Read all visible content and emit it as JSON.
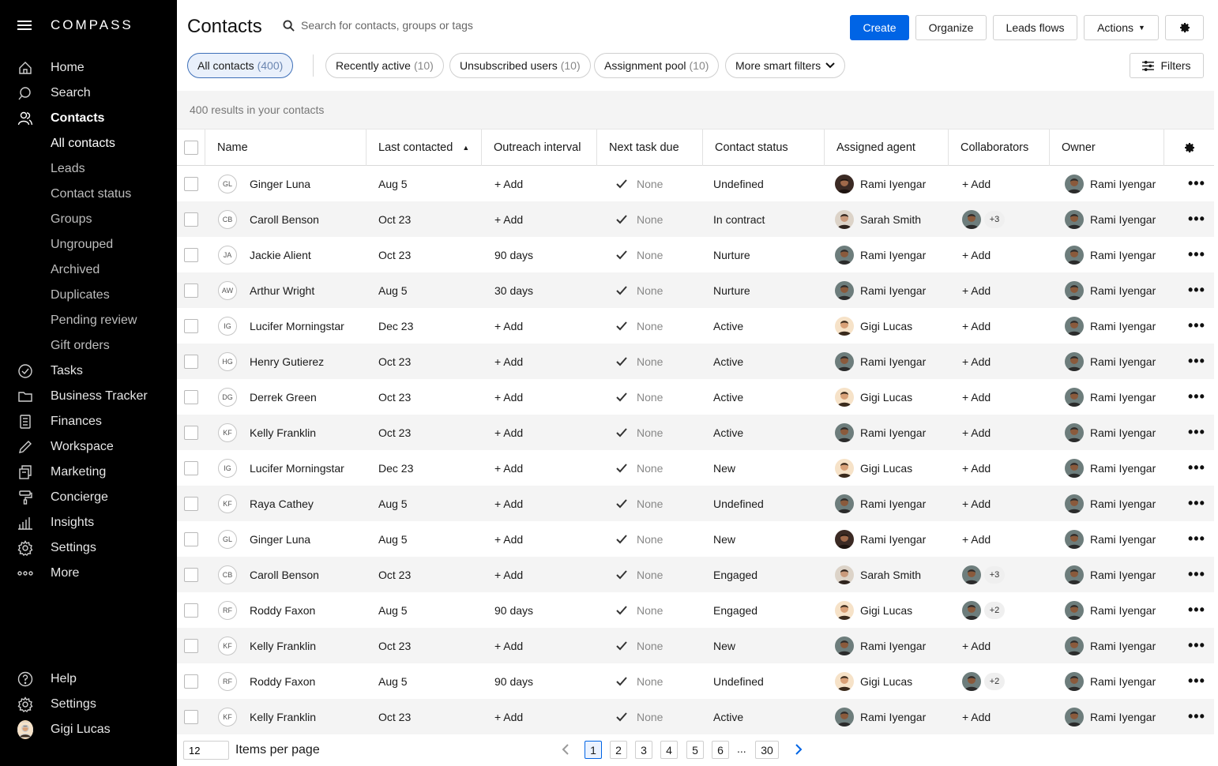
{
  "brand": "COMPASS",
  "nav": [
    {
      "label": "Home",
      "icon": "home-icon"
    },
    {
      "label": "Search",
      "icon": "search-icon"
    },
    {
      "label": "Contacts",
      "icon": "contacts-icon",
      "active": true
    }
  ],
  "subnav": [
    "All contacts",
    "Leads",
    "Contact status",
    "Groups",
    "Ungrouped",
    "Archived",
    "Duplicates",
    "Pending review",
    "Gift orders"
  ],
  "nav2": [
    {
      "label": "Tasks",
      "icon": "tasks-icon"
    },
    {
      "label": "Business Tracker",
      "icon": "folder-icon"
    },
    {
      "label": "Finances",
      "icon": "calculator-icon"
    },
    {
      "label": "Workspace",
      "icon": "pencil-icon"
    },
    {
      "label": "Marketing",
      "icon": "marketing-icon"
    },
    {
      "label": "Concierge",
      "icon": "paint-roller-icon"
    },
    {
      "label": "Insights",
      "icon": "bar-chart-icon"
    },
    {
      "label": "Settings",
      "icon": "gear-icon"
    },
    {
      "label": "More",
      "icon": "more-icon"
    }
  ],
  "bottom_nav": [
    {
      "label": "Help",
      "icon": "help-icon"
    },
    {
      "label": "Settings",
      "icon": "gear-icon"
    }
  ],
  "user": {
    "name": "Gigi Lucas"
  },
  "header": {
    "title": "Contacts",
    "search_placeholder": "Search for contacts, groups or tags",
    "create": "Create",
    "organize": "Organize",
    "leads_flows": "Leads flows",
    "actions": "Actions"
  },
  "filters": {
    "chips": [
      {
        "label": "All contacts",
        "count": "(400)"
      },
      {
        "label": "Recently active",
        "count": "(10)"
      },
      {
        "label": "Unsubscribed users",
        "count": "(10)"
      },
      {
        "label": "Assignment pool",
        "count": "(10)"
      }
    ],
    "more_smart": "More smart filters",
    "filters_btn": "Filters"
  },
  "results_text": "400 results in your contacts",
  "columns": [
    "Name",
    "Last contacted",
    "Outreach interval",
    "Next task due",
    "Contact status",
    "Assigned agent",
    "Collaborators",
    "Owner"
  ],
  "rows": [
    {
      "initials": "GL",
      "name": "Ginger Luna",
      "last": "Aug 5",
      "interval": "+ Add",
      "task": "None",
      "status": "Undefined",
      "agent": "Rami Iyengar",
      "agent_av": "woman-dark",
      "collab": "+ Add",
      "owner": "Rami Iyengar"
    },
    {
      "initials": "CB",
      "name": "Caroll Benson",
      "last": "Oct 23",
      "interval": "+ Add",
      "task": "None",
      "status": "In contract",
      "agent": "Sarah Smith",
      "agent_av": "woman-light",
      "collab": "+3",
      "owner": "Rami Iyengar"
    },
    {
      "initials": "JA",
      "name": "Jackie Alient",
      "last": "Oct 23",
      "interval": "90 days",
      "task": "None",
      "status": "Nurture",
      "agent": "Rami Iyengar",
      "agent_av": "man",
      "collab": "+ Add",
      "owner": "Rami Iyengar"
    },
    {
      "initials": "AW",
      "name": "Arthur Wright",
      "last": "Aug 5",
      "interval": "30 days",
      "task": "None",
      "status": "Nurture",
      "agent": "Rami Iyengar",
      "agent_av": "man",
      "collab": "+ Add",
      "owner": "Rami Iyengar"
    },
    {
      "initials": "IG",
      "name": "Lucifer Morningstar",
      "last": "Dec 23",
      "interval": "+ Add",
      "task": "None",
      "status": "Active",
      "agent": "Gigi Lucas",
      "agent_av": "gigi",
      "collab": "+ Add",
      "owner": "Rami Iyengar"
    },
    {
      "initials": "HG",
      "name": "Henry Gutierez",
      "last": "Oct 23",
      "interval": "+ Add",
      "task": "None",
      "status": "Active",
      "agent": "Rami Iyengar",
      "agent_av": "man",
      "collab": "+ Add",
      "owner": "Rami Iyengar"
    },
    {
      "initials": "DG",
      "name": "Derrek Green",
      "last": "Oct 23",
      "interval": "+ Add",
      "task": "None",
      "status": "Active",
      "agent": "Gigi Lucas",
      "agent_av": "gigi",
      "collab": "+ Add",
      "owner": "Rami Iyengar"
    },
    {
      "initials": "KF",
      "name": "Kelly Franklin",
      "last": "Oct 23",
      "interval": "+ Add",
      "task": "None",
      "status": "Active",
      "agent": "Rami Iyengar",
      "agent_av": "man",
      "collab": "+ Add",
      "owner": "Rami Iyengar"
    },
    {
      "initials": "IG",
      "name": "Lucifer Morningstar",
      "last": "Dec 23",
      "interval": "+ Add",
      "task": "None",
      "status": "New",
      "agent": "Gigi Lucas",
      "agent_av": "gigi",
      "collab": "+ Add",
      "owner": "Rami Iyengar"
    },
    {
      "initials": "KF",
      "name": "Raya Cathey",
      "last": "Aug 5",
      "interval": "+ Add",
      "task": "None",
      "status": "Undefined",
      "agent": "Rami Iyengar",
      "agent_av": "man",
      "collab": "+ Add",
      "owner": "Rami Iyengar"
    },
    {
      "initials": "GL",
      "name": "Ginger Luna",
      "last": "Aug 5",
      "interval": "+ Add",
      "task": "None",
      "status": "New",
      "agent": "Rami Iyengar",
      "agent_av": "woman-dark",
      "collab": "+ Add",
      "owner": "Rami Iyengar"
    },
    {
      "initials": "CB",
      "name": "Caroll Benson",
      "last": "Oct 23",
      "interval": "+ Add",
      "task": "None",
      "status": "Engaged",
      "agent": "Sarah Smith",
      "agent_av": "woman-light",
      "collab": "+3",
      "owner": "Rami Iyengar"
    },
    {
      "initials": "RF",
      "name": "Roddy Faxon",
      "last": "Aug 5",
      "interval": "90 days",
      "task": "None",
      "status": "Engaged",
      "agent": "Gigi Lucas",
      "agent_av": "gigi",
      "collab": "+2",
      "owner": "Rami Iyengar"
    },
    {
      "initials": "KF",
      "name": "Kelly Franklin",
      "last": "Oct 23",
      "interval": "+ Add",
      "task": "None",
      "status": "New",
      "agent": "Rami Iyengar",
      "agent_av": "man",
      "collab": "+ Add",
      "owner": "Rami Iyengar"
    },
    {
      "initials": "RF",
      "name": "Roddy Faxon",
      "last": "Aug 5",
      "interval": "90 days",
      "task": "None",
      "status": "Undefined",
      "agent": "Gigi Lucas",
      "agent_av": "gigi",
      "collab": "+2",
      "owner": "Rami Iyengar"
    },
    {
      "initials": "KF",
      "name": "Kelly Franklin",
      "last": "Oct 23",
      "interval": "+ Add",
      "task": "None",
      "status": "Active",
      "agent": "Rami Iyengar",
      "agent_av": "man",
      "collab": "+ Add",
      "owner": "Rami Iyengar"
    }
  ],
  "pagination": {
    "items_per_page_value": "12",
    "items_per_page_label": "Items per page",
    "pages": [
      "1",
      "2",
      "3",
      "4",
      "5",
      "6"
    ],
    "ellipsis": "...",
    "last_page": "30",
    "current": "1"
  },
  "colors": {
    "primary": "#0064e5",
    "sidebar": "#000000",
    "stripe": "#f4f4f4"
  }
}
